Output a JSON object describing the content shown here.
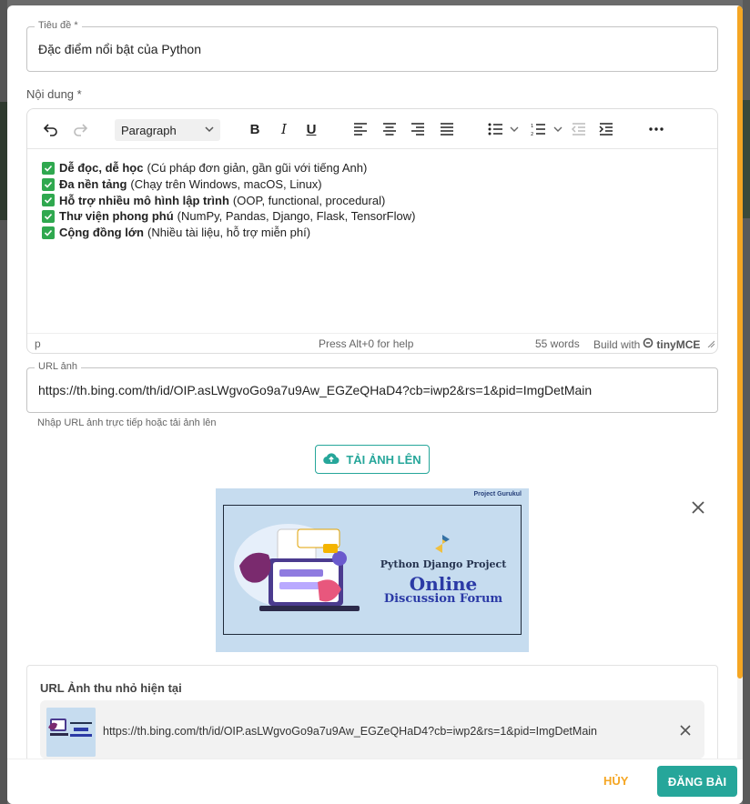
{
  "form": {
    "title_field": {
      "label": "Tiêu đề *",
      "value": "Đặc điểm nổi bật của Python"
    },
    "content_label": "Nội dung *",
    "editor": {
      "block_format": "Paragraph",
      "lines": [
        {
          "bold": "Dễ đọc, dễ học",
          "rest": "(Cú pháp đơn giản, gần gũi với tiếng Anh)"
        },
        {
          "bold": "Đa nền tảng",
          "rest": "(Chạy trên Windows, macOS, Linux)"
        },
        {
          "bold": "Hỗ trợ nhiều mô hình lập trình",
          "rest": "(OOP, functional, procedural)"
        },
        {
          "bold": "Thư viện phong phú",
          "rest": "(NumPy, Pandas, Django, Flask, TensorFlow)"
        },
        {
          "bold": "Cộng đồng lớn",
          "rest": "(Nhiều tài liệu, hỗ trợ miễn phí)"
        }
      ],
      "status": {
        "path": "p",
        "help": "Press Alt+0 for help",
        "words": "55 words",
        "build": "Build with",
        "brand": "tinyMCE"
      }
    },
    "image_url_field": {
      "label": "URL ảnh",
      "value": "https://th.bing.com/th/id/OIP.asLWgvoGo9a7u9Aw_EGZeQHaD4?cb=iwp2&rs=1&pid=ImgDetMain",
      "helper": "Nhập URL ảnh trực tiếp hoặc tải ảnh lên"
    },
    "upload_button": "TẢI ẢNH LÊN",
    "preview": {
      "brand": "Project Gurukul",
      "line1": "Python Django Project",
      "line2": "Online",
      "line3": "Discussion Forum"
    },
    "thumbnail": {
      "title": "URL Ảnh thu nhỏ hiện tại",
      "url": "https://th.bing.com/th/id/OIP.asLWgvoGo9a7u9Aw_EGZeQHaD4?cb=iwp2&rs=1&pid=ImgDetMain"
    }
  },
  "footer": {
    "cancel": "HỦY",
    "submit": "ĐĂNG BÀI"
  },
  "colors": {
    "accent": "#26a69a",
    "warning": "#f5a623",
    "check": "#2fa84f"
  },
  "icons": [
    "undo-icon",
    "redo-icon",
    "bold-icon",
    "italic-icon",
    "underline-icon",
    "align-left-icon",
    "align-center-icon",
    "align-right-icon",
    "align-justify-icon",
    "bullet-list-icon",
    "numbered-list-icon",
    "outdent-icon",
    "indent-icon",
    "more-icon",
    "cloud-upload-icon",
    "close-icon"
  ]
}
